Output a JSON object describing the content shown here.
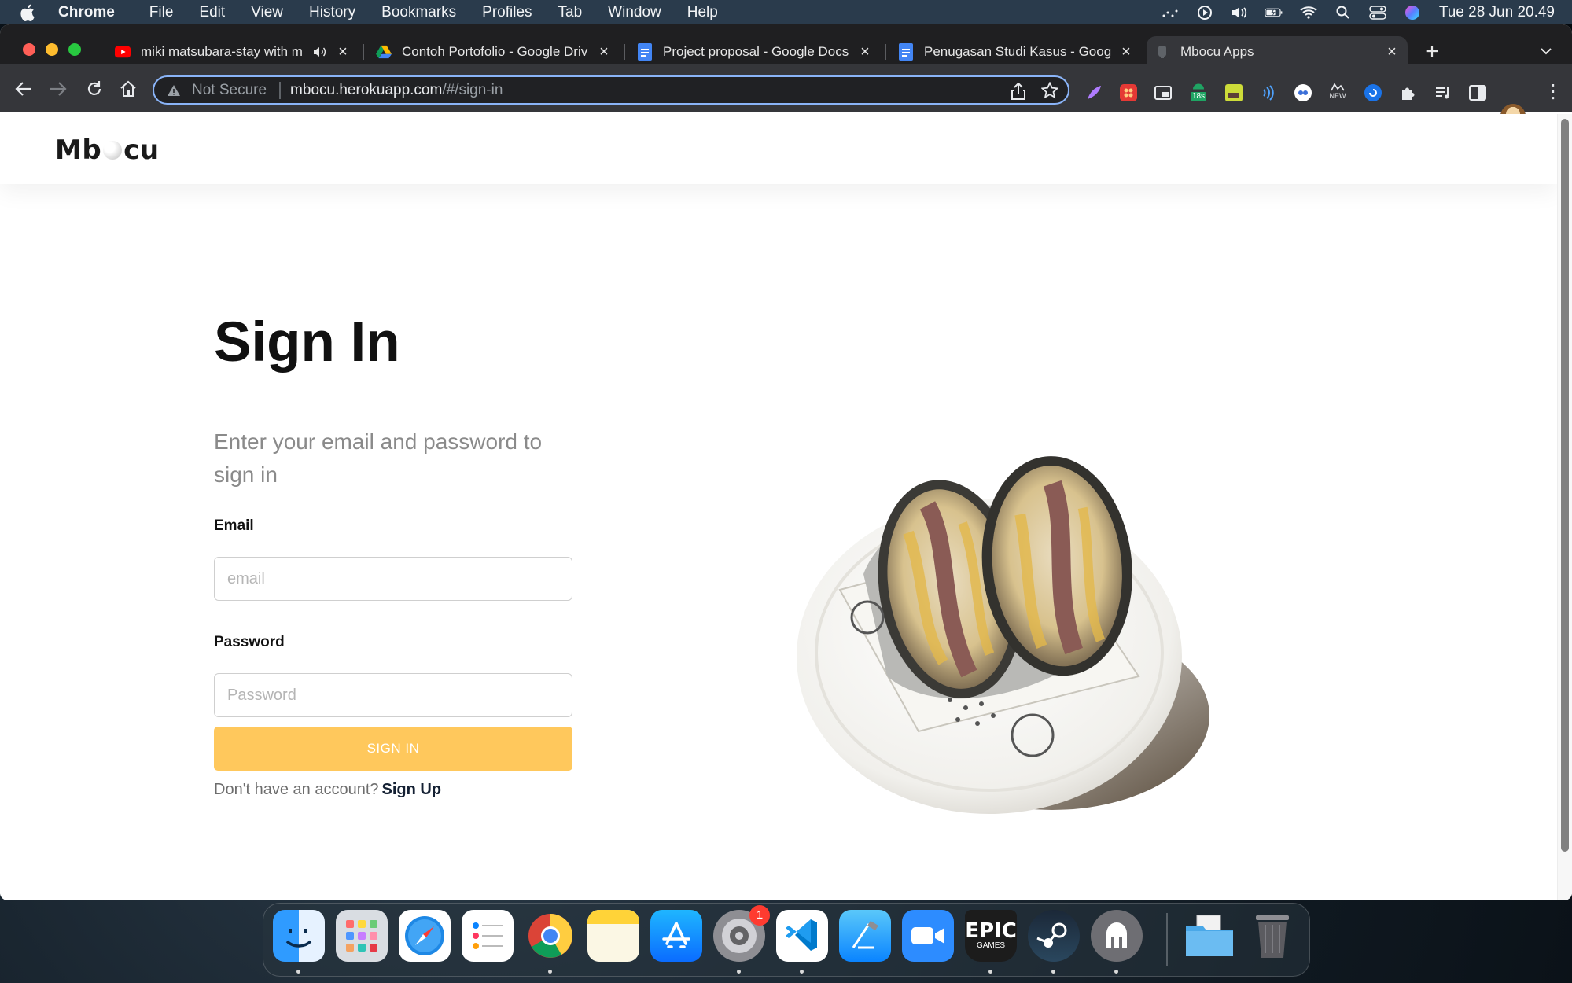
{
  "menubar": {
    "app_name": "Chrome",
    "items": [
      "File",
      "Edit",
      "View",
      "History",
      "Bookmarks",
      "Profiles",
      "Tab",
      "Window",
      "Help"
    ],
    "clock": "Tue 28 Jun  20.49"
  },
  "tabs": [
    {
      "title": "miki matsubara-stay with m",
      "favicon": "youtube-icon",
      "active": false
    },
    {
      "title": "Contoh Portofolio - Google Driv",
      "favicon": "google-drive-icon",
      "active": false
    },
    {
      "title": "Project proposal - Google Docs",
      "favicon": "google-docs-icon",
      "active": false
    },
    {
      "title": "Penugasan Studi Kasus - Goog",
      "favicon": "google-docs-icon",
      "active": false
    },
    {
      "title": "Mbocu Apps",
      "favicon": "site-icon",
      "active": true
    }
  ],
  "omnibox": {
    "security": "Not Secure",
    "host": "mbocu.herokuapp.com",
    "path": "/#/sign-in"
  },
  "extensions": {
    "timer_badge": "18s",
    "new_badge": "NEW"
  },
  "page": {
    "logo_left": "Mb",
    "logo_right": "cu",
    "heading": "Sign In",
    "subtitle": "Enter your email and password to sign in",
    "email_label": "Email",
    "email_placeholder": "email",
    "password_label": "Password",
    "password_placeholder": "Password",
    "submit_label": "SIGN IN",
    "signup_prompt": "Don't have an account?",
    "signup_link": "Sign Up"
  },
  "dock": {
    "apps": [
      "finder",
      "launchpad",
      "safari",
      "reminders",
      "chrome",
      "notes",
      "app-store",
      "system-preferences",
      "vscode",
      "xcode",
      "zoom",
      "epic-games",
      "steam",
      "tableplus",
      "downloads-folder",
      "trash"
    ],
    "system_preferences_badge": "1",
    "epic_label_top": "EPIC",
    "epic_label_bottom": "GAMES"
  },
  "colors": {
    "accent_button": "#ffc85c",
    "omnibox_focus": "#8ab4f8",
    "link": "#142033"
  }
}
